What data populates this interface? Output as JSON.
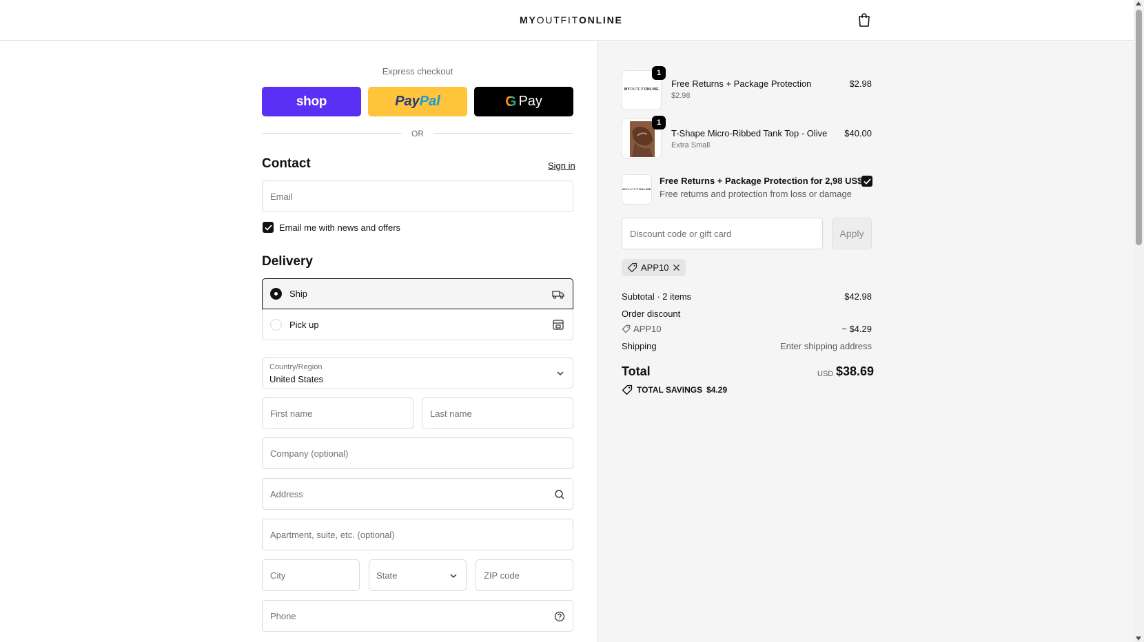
{
  "header": {
    "logo_bold_1": "MY",
    "logo_light": "OUTFIT",
    "logo_bold_2": "ONLINE"
  },
  "express": {
    "label": "Express checkout",
    "shop_label": "shop",
    "paypal_label_1": "Pay",
    "paypal_label_2": "Pal",
    "gpay_g": "G",
    "gpay_label": "Pay",
    "or_label": "OR"
  },
  "contact": {
    "title": "Contact",
    "signin_label": "Sign in",
    "email_placeholder": "Email",
    "newsletter_label": "Email me with news and offers",
    "newsletter_checked": true
  },
  "delivery": {
    "title": "Delivery",
    "options": [
      {
        "label": "Ship",
        "selected": true,
        "icon": "truck-icon"
      },
      {
        "label": "Pick up",
        "selected": false,
        "icon": "store-icon"
      }
    ],
    "country_label": "Country/Region",
    "country_value": "United States",
    "first_name_placeholder": "First name",
    "last_name_placeholder": "Last name",
    "company_placeholder": "Company (optional)",
    "address_placeholder": "Address",
    "apartment_placeholder": "Apartment, suite, etc. (optional)",
    "city_placeholder": "City",
    "state_placeholder": "State",
    "zip_placeholder": "ZIP code",
    "phone_placeholder": "Phone"
  },
  "summary": {
    "items": [
      {
        "name": "Free Returns + Package Protection",
        "variant": "$2.98",
        "price": "$2.98",
        "quantity": "1",
        "thumb_bold_1": "MY",
        "thumb_light": "OUTFIT",
        "thumb_bold_2": "ONLINE"
      },
      {
        "name": "T-Shape Micro-Ribbed Tank Top - Olive",
        "variant": "Extra Small",
        "price": "$40.00",
        "quantity": "1"
      }
    ],
    "upsell": {
      "title": "Free Returns + Package Protection for 2,98 US$",
      "description": "Free returns and protection from loss or damage",
      "checked": true
    },
    "discount_placeholder": "Discount code or gift card",
    "apply_label": "Apply",
    "applied_code": "APP10",
    "subtotal_label": "Subtotal · 2 items",
    "subtotal_value": "$42.98",
    "order_discount_label": "Order discount",
    "discount_code": "APP10",
    "discount_value": "− $4.29",
    "shipping_label": "Shipping",
    "shipping_value": "Enter shipping address",
    "total_label": "Total",
    "total_currency": "USD",
    "total_value": "$38.69",
    "savings_label": "TOTAL SAVINGS",
    "savings_value": "$4.29"
  },
  "colors": {
    "shop_pay": "#5a31f4",
    "paypal": "#ffc439",
    "gpay": "#000000",
    "summary_bg": "#f5f5f5"
  }
}
